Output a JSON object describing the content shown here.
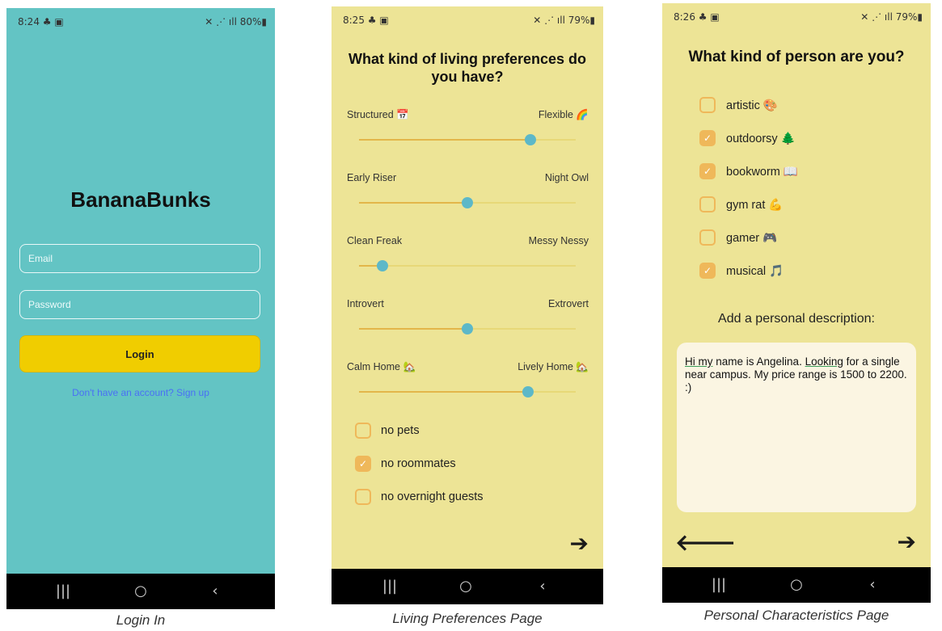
{
  "screen1": {
    "status_time": "8:24",
    "status_icons_left": "♣ ▣",
    "status_right": "✕ ⋰ ıll 80%▮",
    "brand": "BananaBunks",
    "email_placeholder": "Email",
    "password_placeholder": "Password",
    "login_label": "Login",
    "signup_link": "Don't have an account? Sign up",
    "caption": "Login In"
  },
  "screen2": {
    "status_time": "8:25",
    "status_icons_left": "♣ ▣",
    "status_right": "✕ ⋰ ıll 79%▮",
    "title": "What kind of living preferences do you have?",
    "sliders": [
      {
        "left": "Structured 📅",
        "right": "Flexible 🌈",
        "value": 0.79
      },
      {
        "left": "Early Riser",
        "right": "Night Owl",
        "value": 0.5
      },
      {
        "left": "Clean Freak",
        "right": "Messy Nessy",
        "value": 0.11
      },
      {
        "left": "Introvert",
        "right": "Extrovert",
        "value": 0.5
      },
      {
        "left": "Calm Home 🏡",
        "right": "Lively Home 🏡",
        "value": 0.78
      }
    ],
    "checkboxes": [
      {
        "label": "no pets",
        "checked": false
      },
      {
        "label": "no roommates",
        "checked": true
      },
      {
        "label": "no overnight guests",
        "checked": false
      }
    ],
    "next_arrow": "➔",
    "caption": "Living Preferences Page"
  },
  "screen3": {
    "status_time": "8:26",
    "status_icons_left": "♣ ▣",
    "status_right": "✕ ⋰ ıll 79%▮",
    "title": "What kind of person are you?",
    "traits": [
      {
        "label": "artistic 🎨",
        "checked": false
      },
      {
        "label": "outdoorsy 🌲",
        "checked": true
      },
      {
        "label": "bookworm 📖",
        "checked": true
      },
      {
        "label": "gym rat 💪",
        "checked": false
      },
      {
        "label": "gamer 🎮",
        "checked": false
      },
      {
        "label": "musical 🎵",
        "checked": true
      }
    ],
    "description_label": "Add a personal description:",
    "description": {
      "w1": "Hi my",
      "t1": " name is Angelina. ",
      "w2": "Looking",
      "t2": " for a single near campus. My price range is 1500 to 2200. :)"
    },
    "back_arrow": "🡐",
    "next_arrow": "➔",
    "caption": "Personal Characteristics Page"
  },
  "navbar": {
    "recents": "|||",
    "home": "○",
    "back": "‹"
  },
  "colors": {
    "teal": "#63c4c4",
    "yellow_bg": "#ede496",
    "login_yellow": "#f0cd00",
    "accent_orange": "#efb85a",
    "thumb_blue": "#5db8c8"
  }
}
